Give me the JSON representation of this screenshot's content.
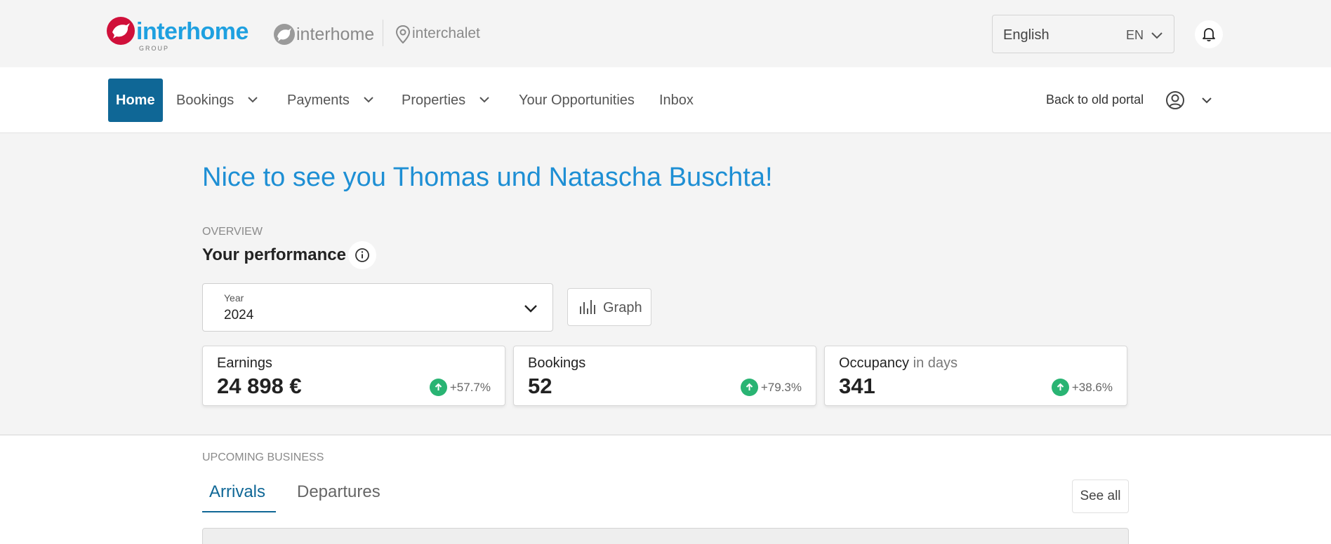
{
  "brand": {
    "main_name": "interhome",
    "group_label": "GROUP",
    "sub_brand_1": "interhome",
    "sub_brand_2": "interchalet",
    "primary_color": "#d0103a",
    "accent_color": "#1ea0e0"
  },
  "language": {
    "label": "English",
    "code": "EN"
  },
  "nav": {
    "items": [
      {
        "label": "Home",
        "active": true,
        "has_dropdown": false
      },
      {
        "label": "Bookings",
        "active": false,
        "has_dropdown": true
      },
      {
        "label": "Payments",
        "active": false,
        "has_dropdown": true
      },
      {
        "label": "Properties",
        "active": false,
        "has_dropdown": true
      },
      {
        "label": "Your Opportunities",
        "active": false,
        "has_dropdown": false
      },
      {
        "label": "Inbox",
        "active": false,
        "has_dropdown": false
      }
    ],
    "old_portal_link": "Back to old portal",
    "active_color": "#0f6796"
  },
  "greeting": "Nice to see you Thomas und Natascha Buschta!",
  "overview": {
    "section_label": "OVERVIEW",
    "title": "Your performance",
    "period_select": {
      "label": "Year",
      "value": "2024"
    },
    "graph_button": "Graph"
  },
  "kpis": [
    {
      "title": "Earnings",
      "title_suffix": "",
      "value": "24 898 €",
      "delta": "+57.7%"
    },
    {
      "title": "Bookings",
      "title_suffix": "",
      "value": "52",
      "delta": "+79.3%"
    },
    {
      "title": "Occupancy",
      "title_suffix": "in days",
      "value": "341",
      "delta": "+38.6%"
    }
  ],
  "upcoming": {
    "section_label": "UPCOMING BUSINESS",
    "tabs": [
      {
        "label": "Arrivals",
        "active": true
      },
      {
        "label": "Departures",
        "active": false
      }
    ],
    "see_all": "See all",
    "positive_color": "#29b473"
  }
}
